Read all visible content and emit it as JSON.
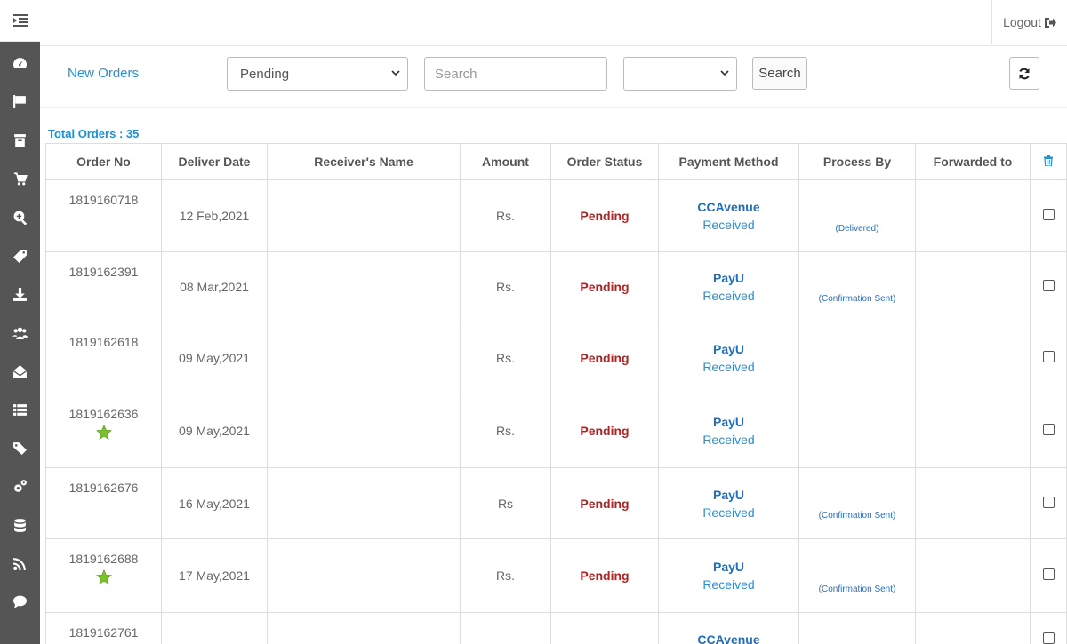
{
  "topbar": {
    "logout_label": "Logout"
  },
  "sidebar": {
    "icons": [
      "dashboard-icon",
      "flag-icon",
      "archive-icon",
      "cart-icon",
      "search-plus-icon",
      "tag-icon",
      "download-icon",
      "users-icon",
      "envelope-open-icon",
      "list-icon",
      "tags-icon",
      "cogs-icon",
      "database-icon",
      "rss-icon",
      "comment-icon"
    ]
  },
  "filters": {
    "title": "New Orders",
    "status_selected": "Pending",
    "search_placeholder": "Search",
    "second_select_value": "",
    "search_button": "Search"
  },
  "total_orders_label": "Total Orders : 35",
  "table": {
    "headers": [
      "Order No",
      "Deliver Date",
      "Receiver's Name",
      "Amount",
      "Order Status",
      "Payment Method",
      "Process By",
      "Forwarded to"
    ],
    "rows": [
      {
        "order_no": "1819160718",
        "starred": false,
        "date": "12 Feb,2021",
        "receiver": "",
        "amount": "Rs.",
        "status": "Pending",
        "pay_method": "CCAvenue",
        "pay_status": "Received",
        "process": "(Delivered)",
        "forwarded": ""
      },
      {
        "order_no": "1819162391",
        "starred": false,
        "date": "08 Mar,2021",
        "receiver": "",
        "amount": "Rs.",
        "status": "Pending",
        "pay_method": "PayU",
        "pay_status": "Received",
        "process": "(Confirmation Sent)",
        "forwarded": ""
      },
      {
        "order_no": "1819162618",
        "starred": false,
        "date": "09 May,2021",
        "receiver": "",
        "amount": "Rs.",
        "status": "Pending",
        "pay_method": "PayU",
        "pay_status": "Received",
        "process": "",
        "forwarded": ""
      },
      {
        "order_no": "1819162636",
        "starred": true,
        "date": "09 May,2021",
        "receiver": "",
        "amount": "Rs.",
        "status": "Pending",
        "pay_method": "PayU",
        "pay_status": "Received",
        "process": "",
        "forwarded": ""
      },
      {
        "order_no": "1819162676",
        "starred": false,
        "date": "16 May,2021",
        "receiver": "",
        "amount": "Rs",
        "status": "Pending",
        "pay_method": "PayU",
        "pay_status": "Received",
        "process": "(Confirmation Sent)",
        "forwarded": ""
      },
      {
        "order_no": "1819162688",
        "starred": true,
        "date": "17 May,2021",
        "receiver": "",
        "amount": "Rs.",
        "status": "Pending",
        "pay_method": "PayU",
        "pay_status": "Received",
        "process": "(Confirmation Sent)",
        "forwarded": ""
      },
      {
        "order_no": "1819162761",
        "starred": false,
        "date": "",
        "receiver": "",
        "amount": "",
        "status": "",
        "pay_method": "CCAvenue",
        "pay_status": "",
        "process": "",
        "forwarded": ""
      }
    ]
  },
  "colors": {
    "sidebar_bg": "#555555",
    "accent": "#2a8fd0",
    "pending": "#b22222",
    "star": "#7cc22e"
  }
}
